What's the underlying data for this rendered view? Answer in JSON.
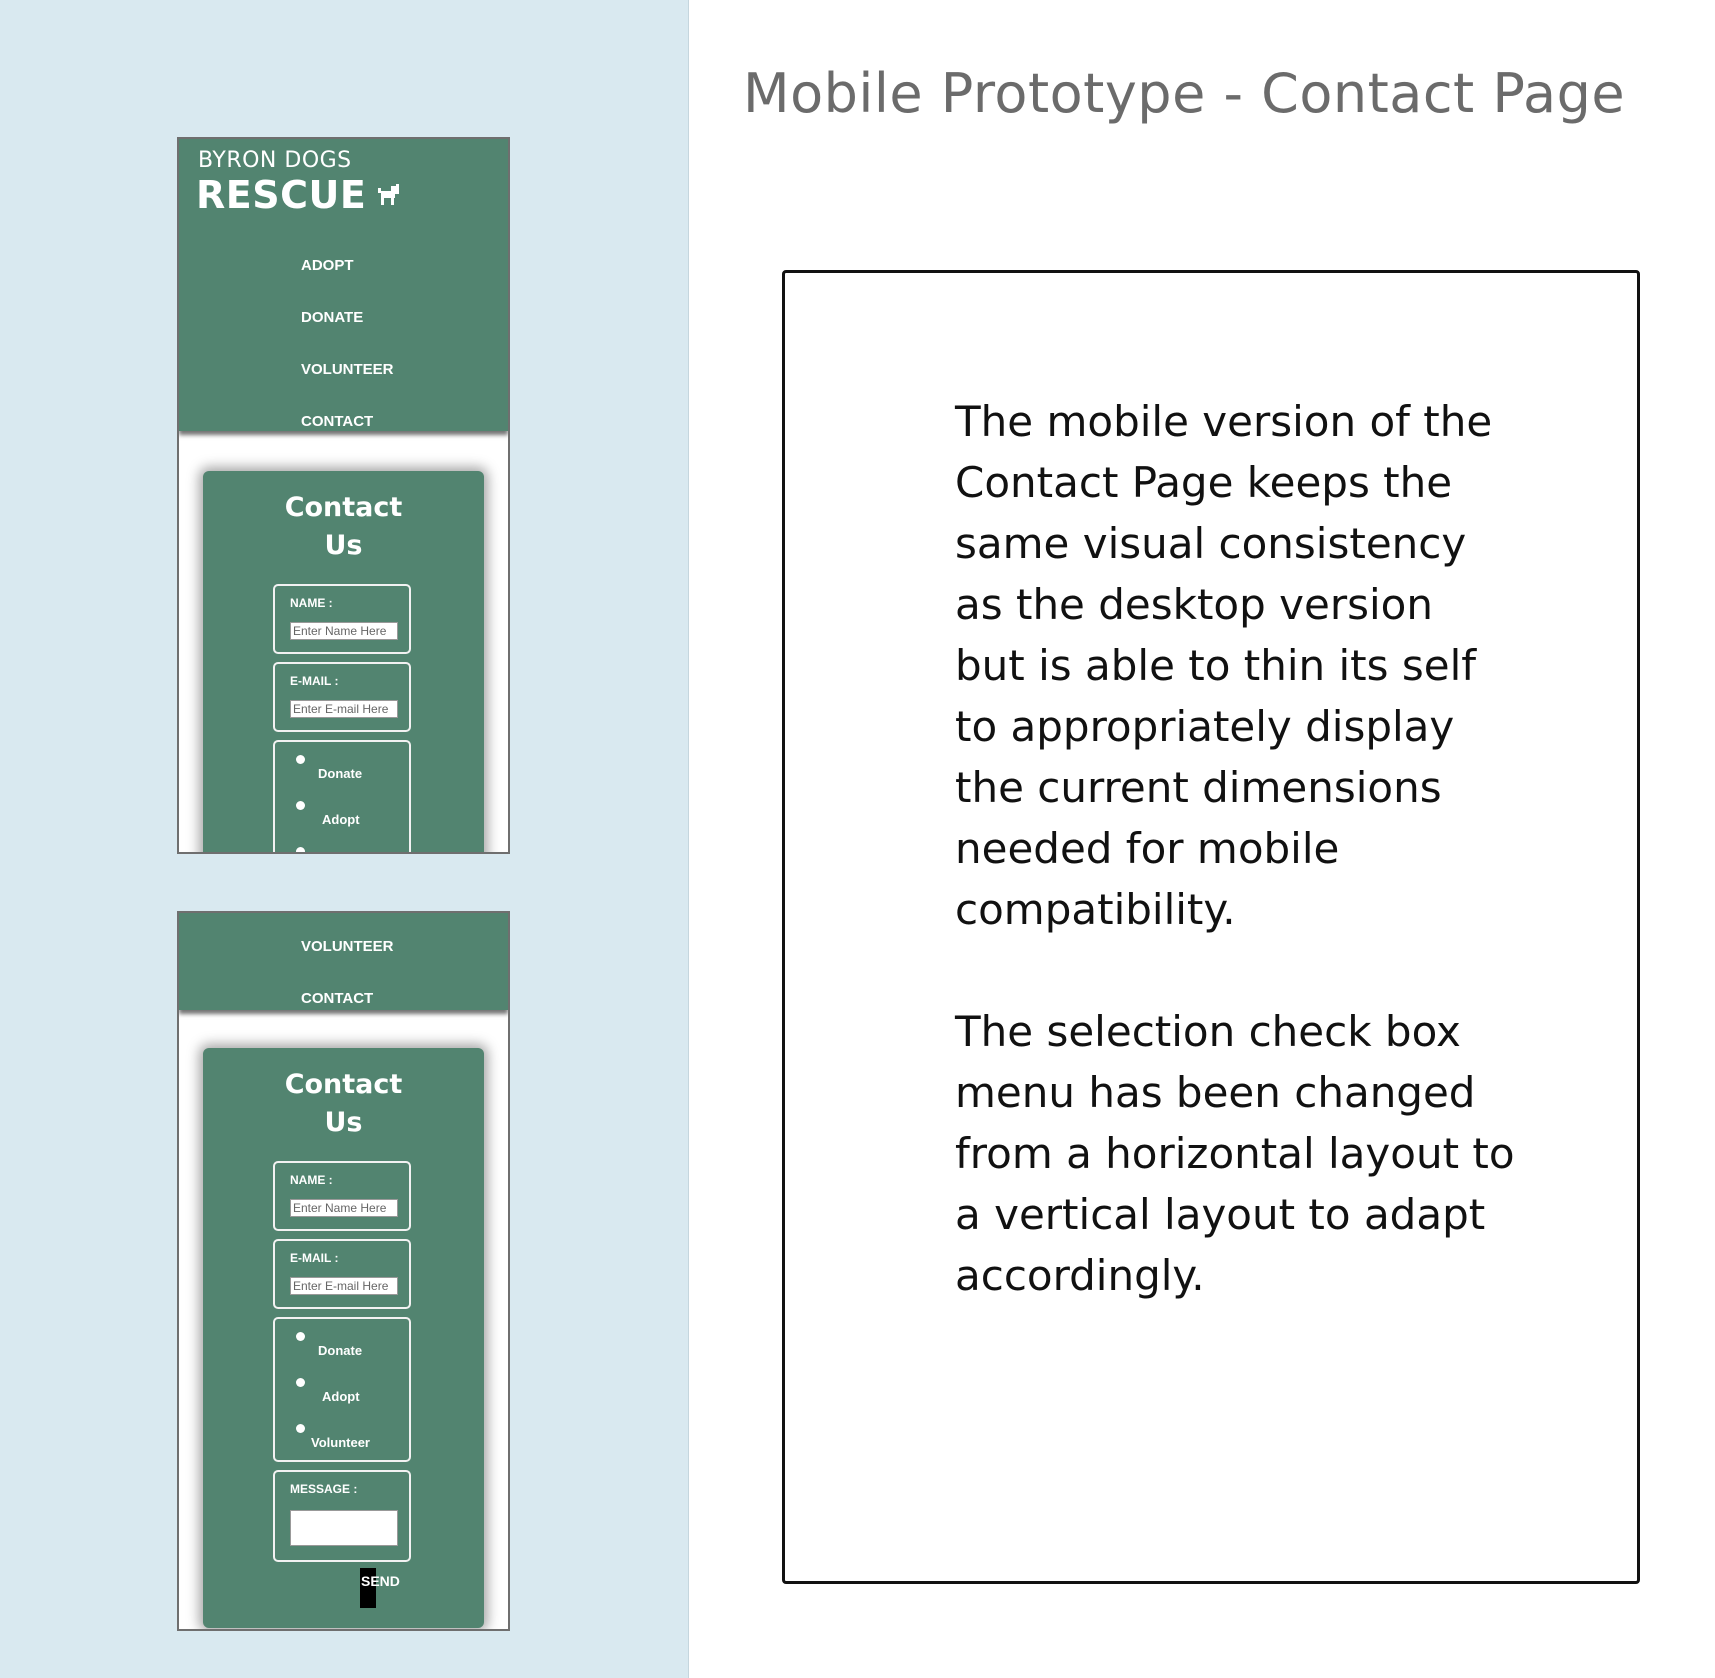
{
  "title": "Mobile Prototype - Contact Page",
  "description": {
    "paragraph_1": "The mobile version of the Contact Page keeps the same visual consistency as the desktop version but is able to thin its self to appropriately display the current dimensions needed for mobile compatibility.",
    "paragraph_2": "The selection check box menu has been changed from a horizontal layout to a vertical layout to adapt accordingly."
  },
  "colors": {
    "accent": "#528470",
    "panel_bg": "#d9e9f0"
  },
  "site": {
    "logo_top": "BYRON DOGS",
    "logo_main": "RESCUE",
    "logo_icon": "dog-icon",
    "nav": [
      "ADOPT",
      "DONATE",
      "VOLUNTEER",
      "CONTACT"
    ]
  },
  "form": {
    "title_line1": "Contact",
    "title_line2": "Us",
    "name_label": "NAME :",
    "name_placeholder": "Enter Name Here",
    "email_label": "E-MAIL :",
    "email_placeholder": "Enter E-mail Here",
    "options": [
      "Donate",
      "Adopt",
      "Volunteer"
    ],
    "message_label": "MESSAGE :",
    "send_label": "SEND"
  }
}
